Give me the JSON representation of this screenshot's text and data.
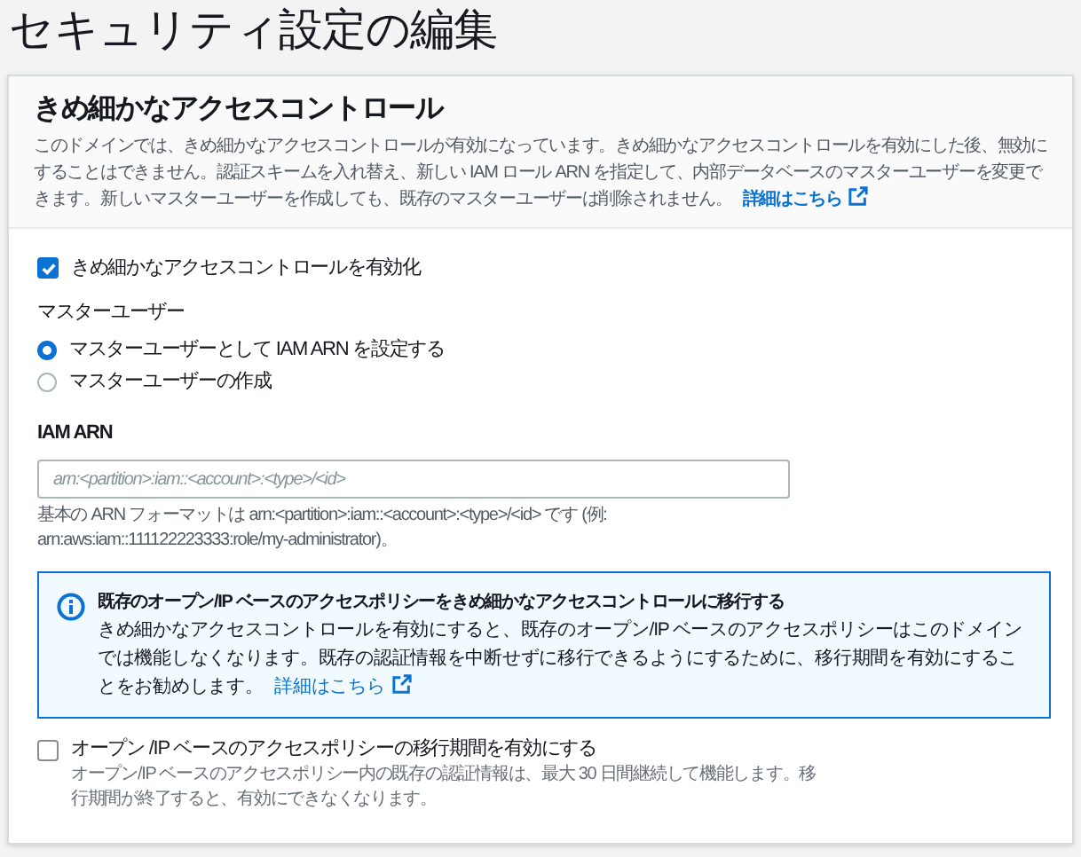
{
  "page_title": "セキュリティ設定の編集",
  "section": {
    "title": "きめ細かなアクセスコントロール",
    "description": "このドメインでは、きめ細かなアクセスコントロールが有効になっています。きめ細かなアクセスコントロールを有効にした後、無効にすることはできません。認証スキームを入れ替え、新しい IAM ロール ARN を指定して、内部データベースのマスターユーザーを変更できます。新しいマスターユーザーを作成しても、既存のマスターユーザーは削除されません。",
    "link": "詳細はこちら"
  },
  "enable_checkbox": {
    "label": "きめ細かなアクセスコントロールを有効化",
    "checked": true
  },
  "master_user": {
    "label": "マスターユーザー",
    "options": [
      {
        "label": "マスターユーザーとして IAM ARN を設定する",
        "selected": true
      },
      {
        "label": "マスターユーザーの作成",
        "selected": false
      }
    ]
  },
  "iam_arn": {
    "label": "IAM ARN",
    "placeholder": "arn:<partition>:iam::<account>:<type>/<id>",
    "hint": "基本の ARN フォーマットは arn:<partition>:iam::<account>:<type>/<id> です (例: arn:aws:iam::111122223333:role/my-administrator)。"
  },
  "info_alert": {
    "title": "既存のオープン/IP ベースのアクセスポリシーをきめ細かなアクセスコントロールに移行する",
    "body": "きめ細かなアクセスコントロールを有効にすると、既存のオープン/IP ベースのアクセスポリシーはこのドメインでは機能しなくなります。既存の認証情報を中断せずに移行できるようにするために、移行期間を有効にすることをお勧めします。",
    "link": "詳細はこちら"
  },
  "migration_checkbox": {
    "label": "オープン /IP ベースのアクセスポリシーの移行期間を有効にする",
    "description": "オープン/IP ベースのアクセスポリシー内の既存の認証情報は、最大 30 日間継続して機能します。移行期間が終了すると、有効にできなくなります。",
    "checked": false
  }
}
